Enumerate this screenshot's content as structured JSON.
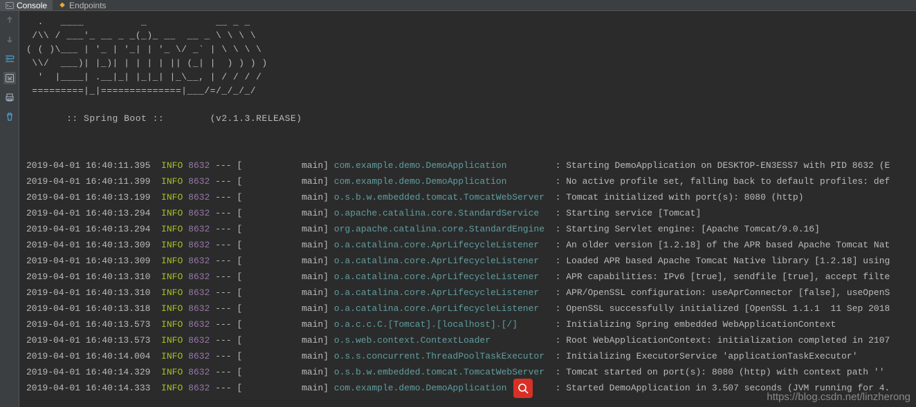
{
  "tabs": {
    "console": "Console",
    "endpoints": "Endpoints"
  },
  "spring_banner": [
    "  .   ____          _            __ _ _",
    " /\\\\ / ___'_ __ _ _(_)_ __  __ _ \\ \\ \\ \\",
    "( ( )\\___ | '_ | '_| | '_ \\/ _` | \\ \\ \\ \\",
    " \\\\/  ___)| |_)| | | | | || (_| |  ) ) ) )",
    "  '  |____| .__|_| |_|_| |_\\__, | / / / /",
    " =========|_|==============|___/=/_/_/_/"
  ],
  "boot_name": " :: Spring Boot :: ",
  "boot_version": "       (v2.1.3.RELEASE)",
  "log_lines": [
    {
      "ts": "2019-04-01 16:40:11.395",
      "level": "INFO",
      "pid": "8632",
      "thread": "main",
      "logger": "com.example.demo.DemoApplication       ",
      "msg": "Starting DemoApplication on DESKTOP-EN3ESS7 with PID 8632 (E"
    },
    {
      "ts": "2019-04-01 16:40:11.399",
      "level": "INFO",
      "pid": "8632",
      "thread": "main",
      "logger": "com.example.demo.DemoApplication       ",
      "msg": "No active profile set, falling back to default profiles: def"
    },
    {
      "ts": "2019-04-01 16:40:13.199",
      "level": "INFO",
      "pid": "8632",
      "thread": "main",
      "logger": "o.s.b.w.embedded.tomcat.TomcatWebServer",
      "msg": "Tomcat initialized with port(s): 8080 (http)"
    },
    {
      "ts": "2019-04-01 16:40:13.294",
      "level": "INFO",
      "pid": "8632",
      "thread": "main",
      "logger": "o.apache.catalina.core.StandardService ",
      "msg": "Starting service [Tomcat]"
    },
    {
      "ts": "2019-04-01 16:40:13.294",
      "level": "INFO",
      "pid": "8632",
      "thread": "main",
      "logger": "org.apache.catalina.core.StandardEngine",
      "msg": "Starting Servlet engine: [Apache Tomcat/9.0.16]"
    },
    {
      "ts": "2019-04-01 16:40:13.309",
      "level": "INFO",
      "pid": "8632",
      "thread": "main",
      "logger": "o.a.catalina.core.AprLifecycleListener ",
      "msg": "An older version [1.2.18] of the APR based Apache Tomcat Nat"
    },
    {
      "ts": "2019-04-01 16:40:13.309",
      "level": "INFO",
      "pid": "8632",
      "thread": "main",
      "logger": "o.a.catalina.core.AprLifecycleListener ",
      "msg": "Loaded APR based Apache Tomcat Native library [1.2.18] using"
    },
    {
      "ts": "2019-04-01 16:40:13.310",
      "level": "INFO",
      "pid": "8632",
      "thread": "main",
      "logger": "o.a.catalina.core.AprLifecycleListener ",
      "msg": "APR capabilities: IPv6 [true], sendfile [true], accept filte"
    },
    {
      "ts": "2019-04-01 16:40:13.310",
      "level": "INFO",
      "pid": "8632",
      "thread": "main",
      "logger": "o.a.catalina.core.AprLifecycleListener ",
      "msg": "APR/OpenSSL configuration: useAprConnector [false], useOpenS"
    },
    {
      "ts": "2019-04-01 16:40:13.318",
      "level": "INFO",
      "pid": "8632",
      "thread": "main",
      "logger": "o.a.catalina.core.AprLifecycleListener ",
      "msg": "OpenSSL successfully initialized [OpenSSL 1.1.1  11 Sep 2018"
    },
    {
      "ts": "2019-04-01 16:40:13.573",
      "level": "INFO",
      "pid": "8632",
      "thread": "main",
      "logger": "o.a.c.c.C.[Tomcat].[localhost].[/]     ",
      "msg": "Initializing Spring embedded WebApplicationContext"
    },
    {
      "ts": "2019-04-01 16:40:13.573",
      "level": "INFO",
      "pid": "8632",
      "thread": "main",
      "logger": "o.s.web.context.ContextLoader          ",
      "msg": "Root WebApplicationContext: initialization completed in 2107"
    },
    {
      "ts": "2019-04-01 16:40:14.004",
      "level": "INFO",
      "pid": "8632",
      "thread": "main",
      "logger": "o.s.s.concurrent.ThreadPoolTaskExecutor",
      "msg": "Initializing ExecutorService 'applicationTaskExecutor'"
    },
    {
      "ts": "2019-04-01 16:40:14.329",
      "level": "INFO",
      "pid": "8632",
      "thread": "main",
      "logger": "o.s.b.w.embedded.tomcat.TomcatWebServer",
      "msg": "Tomcat started on port(s): 8080 (http) with context path ''"
    },
    {
      "ts": "2019-04-01 16:40:14.333",
      "level": "INFO",
      "pid": "8632",
      "thread": "main",
      "logger": "com.example.demo.DemoApplication       ",
      "msg": "Started DemoApplication in 3.507 seconds (JVM running for 4."
    }
  ],
  "watermark": "https://blog.csdn.net/linzherong"
}
